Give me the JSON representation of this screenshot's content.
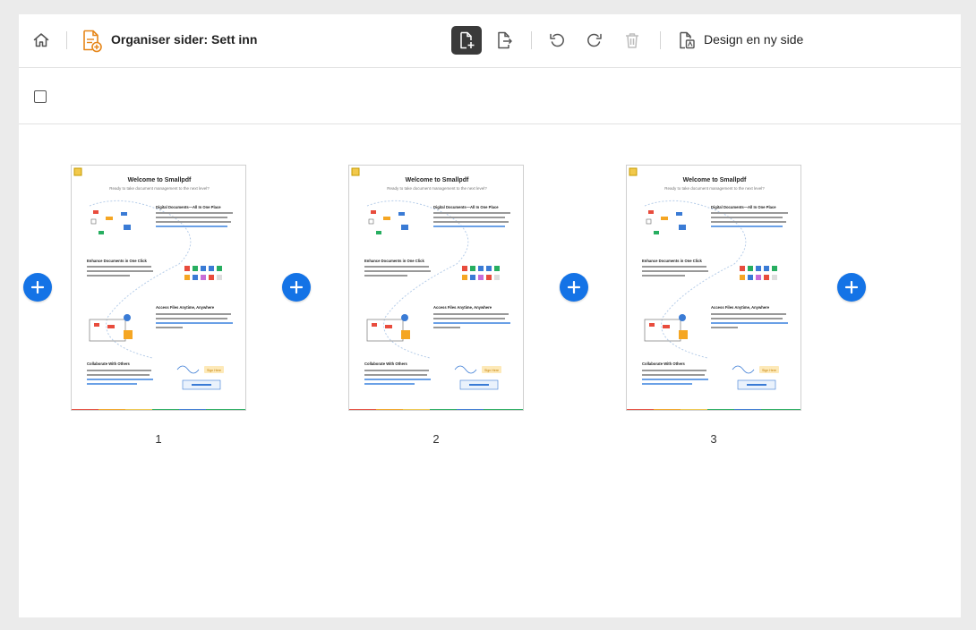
{
  "toolbar": {
    "title": "Organiser sider: Sett inn",
    "design_label": "Design en ny side",
    "icons": {
      "home": "home-icon",
      "doc": "document-add-icon",
      "insert": "insert-page-icon",
      "extract": "extract-page-icon",
      "undo": "undo-icon",
      "redo": "redo-icon",
      "delete": "trash-icon",
      "design": "design-page-icon"
    }
  },
  "colors": {
    "accent": "#1473e6",
    "doc_icon": "#e68619",
    "active_tool": "#3a3a3a"
  },
  "pages": [
    {
      "number": "1"
    },
    {
      "number": "2"
    },
    {
      "number": "3"
    }
  ],
  "thumbnail": {
    "heading": "Welcome to Smallpdf",
    "subheading": "Ready to take document management to the next level?",
    "sections": [
      "Digital Documents—All In One Place",
      "Enhance Documents in One Click",
      "Access Files Anytime, Anywhere",
      "Collaborate With Others"
    ],
    "sign_here": "Sign Here"
  }
}
